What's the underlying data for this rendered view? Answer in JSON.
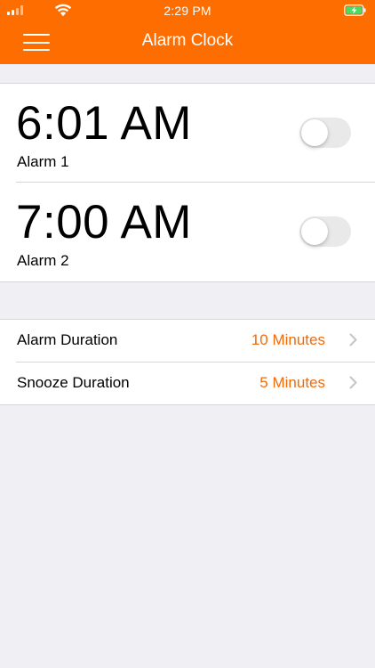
{
  "status_bar": {
    "time": "2:29 PM"
  },
  "header": {
    "title": "Alarm Clock",
    "menu_icon": "hamburger-menu-icon"
  },
  "alarms": [
    {
      "time": "6:01 AM",
      "name": "Alarm 1",
      "enabled": false
    },
    {
      "time": "7:00 AM",
      "name": "Alarm 2",
      "enabled": false
    }
  ],
  "settings": [
    {
      "label": "Alarm Duration",
      "value": "10 Minutes"
    },
    {
      "label": "Snooze Duration",
      "value": "5 Minutes"
    }
  ],
  "colors": {
    "accent": "#fd6d00",
    "value_text": "#f06b0a",
    "background": "#efeff4"
  }
}
